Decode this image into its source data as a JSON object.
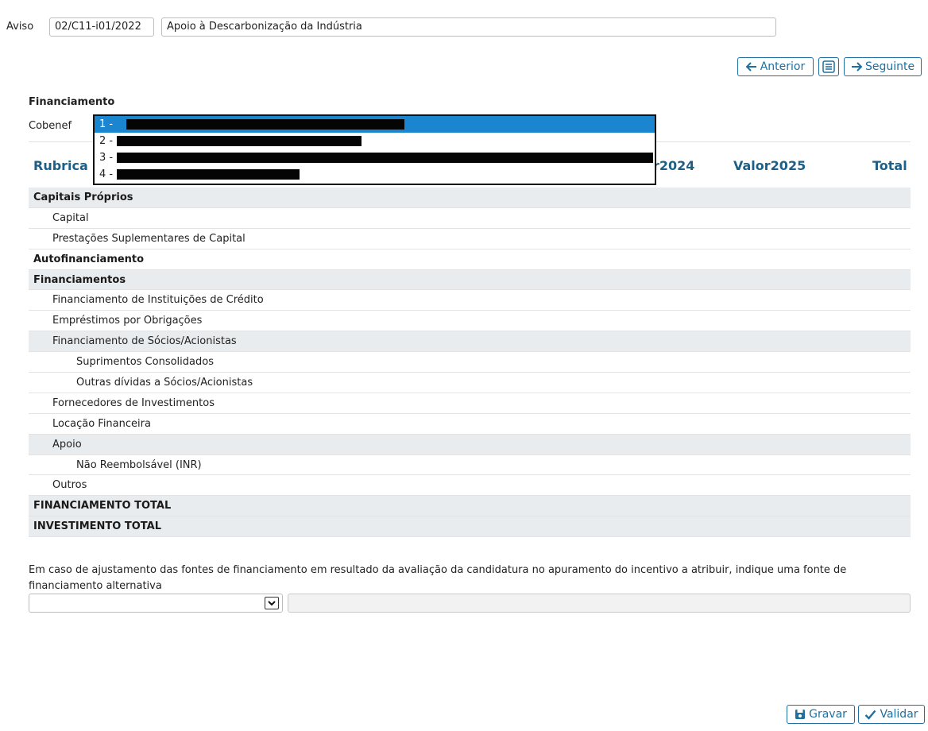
{
  "aviso": {
    "label": "Aviso",
    "code": "02/C11-i01/2022",
    "title": "Apoio à Descarbonização da Indústria"
  },
  "nav": {
    "prev_label": "Anterior",
    "next_label": "Seguinte",
    "prev_icon": "arrow-left-icon",
    "list_icon": "list-icon",
    "next_icon": "arrow-right-icon"
  },
  "financiamento": {
    "title": "Financiamento",
    "cobenef_label": "Cobenef"
  },
  "dropdown": {
    "options": [
      "1 -",
      "2 -",
      "3 -",
      "4 -"
    ],
    "selected_index": 0
  },
  "table": {
    "columns": [
      "Rubrica",
      "r2024",
      "Valor2025",
      "Total"
    ],
    "rows": [
      {
        "label": "Capitais Próprios"
      },
      {
        "label": "Capital"
      },
      {
        "label": "Prestações Suplementares de Capital"
      },
      {
        "label": "Autofinanciamento"
      },
      {
        "label": "Financiamentos"
      },
      {
        "label": "Financiamento de Instituições de Crédito"
      },
      {
        "label": "Empréstimos por Obrigações"
      },
      {
        "label": "Financiamento de Sócios/Acionistas"
      },
      {
        "label": "Suprimentos Consolidados"
      },
      {
        "label": "Outras dívidas a Sócios/Acionistas"
      },
      {
        "label": "Fornecedores de Investimentos"
      },
      {
        "label": "Locação Financeira"
      },
      {
        "label": "Apoio"
      },
      {
        "label": "Não Reembolsável (INR)"
      },
      {
        "label": "Outros"
      },
      {
        "label": "FINANCIAMENTO TOTAL"
      },
      {
        "label": "INVESTIMENTO TOTAL"
      }
    ]
  },
  "alternativa": {
    "text": "Em caso de ajustamento das fontes de financiamento em resultado da avaliação da candidatura no apuramento do incentivo a atribuir, indique uma fonte de financiamento alternativa",
    "select_value": "",
    "input_value": ""
  },
  "actions": {
    "save_label": "Gravar",
    "validate_label": "Validar",
    "save_icon": "floppy-disk-icon",
    "validate_icon": "checkmark-icon"
  },
  "colors": {
    "accent": "#1f6fa1",
    "header_text": "#1d5f86",
    "row_shade": "#e9ecef",
    "selected_option": "#1b86cf"
  }
}
